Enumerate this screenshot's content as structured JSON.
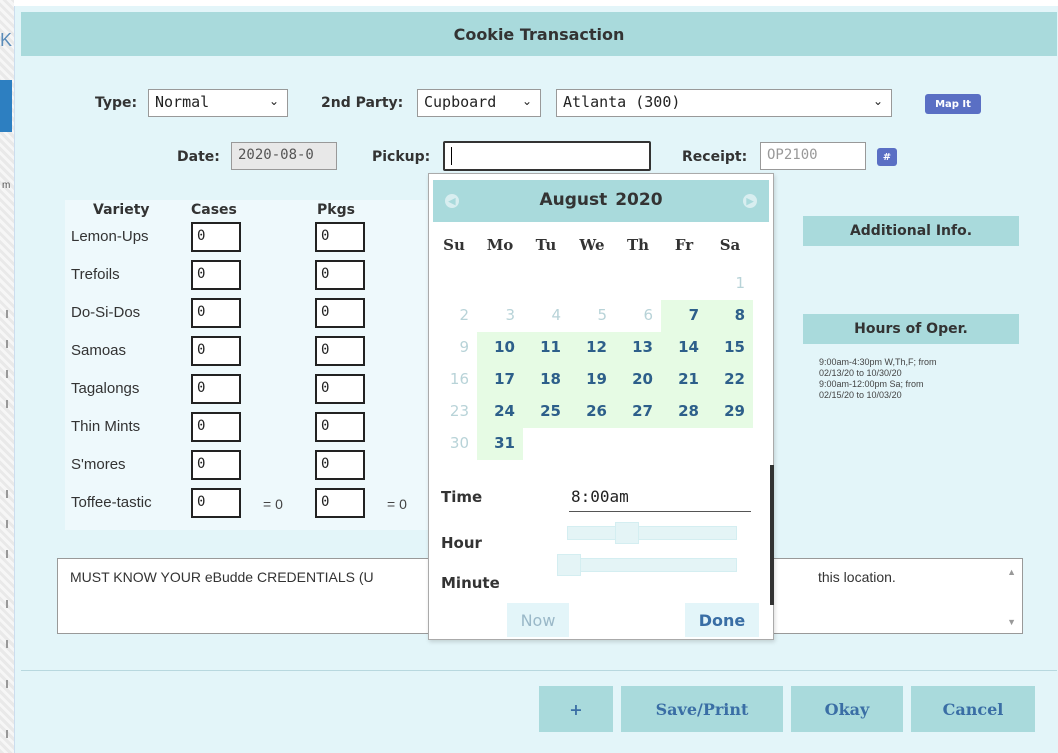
{
  "dialog": {
    "title": "Cookie Transaction"
  },
  "background": {
    "tab_letter": "K",
    "side_letter": "m"
  },
  "form": {
    "type_label": "Type:",
    "type_value": "Normal",
    "second_party_label": "2nd Party:",
    "second_party_value": "Cupboard",
    "location_value": "Atlanta (300)",
    "map_button": "Map It",
    "date_label": "Date:",
    "date_value": "2020-08-0",
    "pickup_label": "Pickup:",
    "pickup_value": "",
    "receipt_label": "Receipt:",
    "receipt_placeholder": "OP2100",
    "hash_button": "#"
  },
  "varieties": {
    "headers": {
      "variety": "Variety",
      "cases": "Cases",
      "pkgs": "Pkgs"
    },
    "rows": [
      {
        "name": "Lemon-Ups",
        "cases": "0",
        "pkgs": "0"
      },
      {
        "name": "Trefoils",
        "cases": "0",
        "pkgs": "0"
      },
      {
        "name": "Do-Si-Dos",
        "cases": "0",
        "pkgs": "0"
      },
      {
        "name": "Samoas",
        "cases": "0",
        "pkgs": "0"
      },
      {
        "name": "Tagalongs",
        "cases": "0",
        "pkgs": "0"
      },
      {
        "name": "Thin Mints",
        "cases": "0",
        "pkgs": "0"
      },
      {
        "name": "S'mores",
        "cases": "0",
        "pkgs": "0"
      },
      {
        "name": "Toffee-tastic",
        "cases": "0",
        "pkgs": "0",
        "cases_total": "= 0",
        "pkgs_total": "= 0"
      }
    ]
  },
  "side": {
    "additional_info": "Additional Info.",
    "hours_title": "Hours of Oper.",
    "hours_lines": [
      "9:00am-4:30pm W,Th,F; from",
      "02/13/20 to 10/30/20",
      "9:00am-12:00pm Sa; from",
      "02/15/20 to 10/03/20"
    ]
  },
  "notes": {
    "text_start": "MUST KNOW YOUR eBudde CREDENTIALS (U",
    "text_end": "this location."
  },
  "buttons": {
    "plus": "+",
    "save_print": "Save/Print",
    "okay": "Okay",
    "cancel": "Cancel"
  },
  "calendar": {
    "month": "August",
    "year": "2020",
    "weekdays": [
      "Su",
      "Mo",
      "Tu",
      "We",
      "Th",
      "Fr",
      "Sa"
    ],
    "weeks": [
      [
        null,
        null,
        null,
        null,
        null,
        null,
        {
          "d": "1",
          "s": "out"
        }
      ],
      [
        {
          "d": "2",
          "s": "out"
        },
        {
          "d": "3",
          "s": "out"
        },
        {
          "d": "4",
          "s": "out"
        },
        {
          "d": "5",
          "s": "out"
        },
        {
          "d": "6",
          "s": "out"
        },
        {
          "d": "7",
          "s": "in"
        },
        {
          "d": "8",
          "s": "in"
        }
      ],
      [
        {
          "d": "9",
          "s": "out"
        },
        {
          "d": "10",
          "s": "in"
        },
        {
          "d": "11",
          "s": "in"
        },
        {
          "d": "12",
          "s": "in"
        },
        {
          "d": "13",
          "s": "in"
        },
        {
          "d": "14",
          "s": "in"
        },
        {
          "d": "15",
          "s": "in"
        }
      ],
      [
        {
          "d": "16",
          "s": "out"
        },
        {
          "d": "17",
          "s": "in"
        },
        {
          "d": "18",
          "s": "in"
        },
        {
          "d": "19",
          "s": "in"
        },
        {
          "d": "20",
          "s": "in"
        },
        {
          "d": "21",
          "s": "in"
        },
        {
          "d": "22",
          "s": "in"
        }
      ],
      [
        {
          "d": "23",
          "s": "out"
        },
        {
          "d": "24",
          "s": "in"
        },
        {
          "d": "25",
          "s": "in"
        },
        {
          "d": "26",
          "s": "in"
        },
        {
          "d": "27",
          "s": "in"
        },
        {
          "d": "28",
          "s": "in"
        },
        {
          "d": "29",
          "s": "in"
        }
      ],
      [
        {
          "d": "30",
          "s": "out"
        },
        {
          "d": "31",
          "s": "in"
        },
        null,
        null,
        null,
        null,
        null
      ]
    ],
    "time_label": "Time",
    "time_value": "8:00am",
    "hour_label": "Hour",
    "minute_label": "Minute",
    "hour_value": 0.33,
    "minute_value": 0.0,
    "now_button": "Now",
    "done_button": "Done"
  },
  "colors": {
    "dialog_bg": "#e3f5f9",
    "header_bg": "#a9dadc",
    "accent_text": "#3a6ea5",
    "available_day_bg": "#e6fbe4",
    "badge_bg": "#5a6fc4"
  }
}
